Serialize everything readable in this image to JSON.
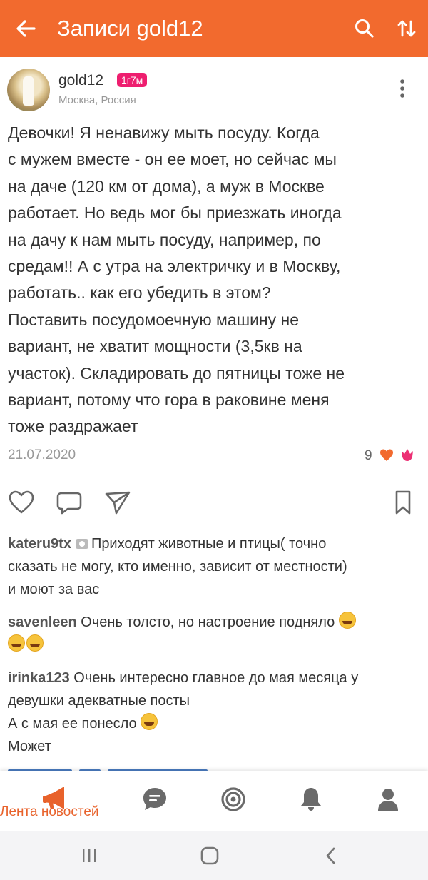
{
  "header": {
    "title": "Записи gold12",
    "back_icon": "arrow-left-icon",
    "search_icon": "search-icon",
    "sort_icon": "sort-arrows-icon",
    "background": "#f26a2e"
  },
  "post": {
    "author": "gold12",
    "badge": "1г7м",
    "badge_color": "#ee1e6f",
    "location": "Москва, Россия",
    "body_lines": [
      "Девочки! Я ненавижу мыть посуду. Когда",
      "с мужем вместе - он ее моет, но сейчас мы",
      "на даче (120 км от дома), а муж в Москве",
      "работает. Но ведь мог бы приезжать иногда",
      "на дачу к нам мыть посуду, например, по",
      "средам!! А с утра на электричку и в Москву,",
      "работать.. как его убедить в этом?",
      "Поставить посудомоечную машину не",
      "вариант, не хватит мощности (3,5кв на",
      "участок). Складировать до пятницы тоже не",
      "вариант, потому что гора в раковине меня",
      "тоже раздражает"
    ],
    "date": "21.07.2020",
    "reactions_count": "9"
  },
  "actions": [
    "heart-icon",
    "comment-icon",
    "share-icon",
    "bookmark-icon"
  ],
  "comments": [
    {
      "user": "kateru9tx",
      "has_photo_icon": true,
      "lines": [
        "Приходят животные и птицы( точно",
        "сказать не могу, кто именно, зависит от местности)",
        "и моют за вас"
      ]
    },
    {
      "user": "savenleen",
      "lines": [
        "Очень толсто, но настроение подняло"
      ],
      "emoji_line_end": 1,
      "emoji_next_line": 2
    },
    {
      "user": "irinka123",
      "lines": [
        "Очень интересно главное до мая месяца у",
        "девушки адекватные посты",
        "А с мая ее понесло",
        "Может"
      ]
    }
  ],
  "tabbar": {
    "active_label": "Лента новостей",
    "active_color": "#e8622b",
    "icons": [
      "megaphone-icon",
      "chat-icon",
      "target-icon",
      "bell-icon",
      "profile-icon"
    ]
  },
  "system_nav": [
    "recent-apps-icon",
    "home-icon",
    "back-icon"
  ]
}
